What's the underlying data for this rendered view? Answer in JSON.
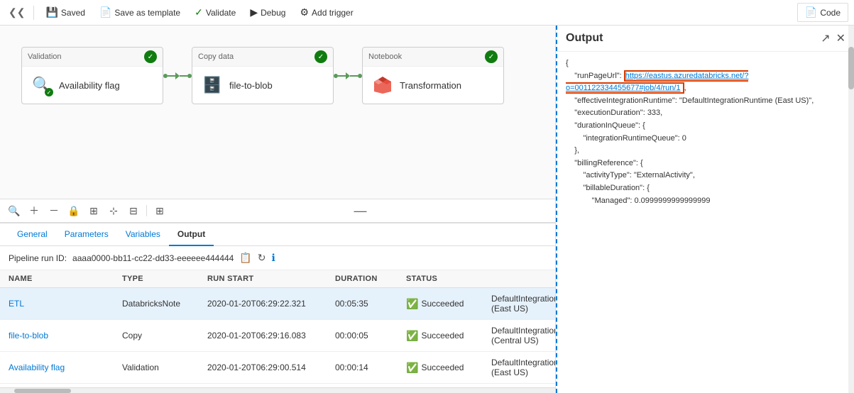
{
  "toolbar": {
    "saved_label": "Saved",
    "save_template_label": "Save as template",
    "validate_label": "Validate",
    "debug_label": "Debug",
    "add_trigger_label": "Add trigger",
    "code_label": "Code"
  },
  "pipeline": {
    "activities": [
      {
        "id": "validation",
        "type_label": "Validation",
        "name": "Availability flag",
        "icon": "🔍",
        "icon_color": "#0078d4",
        "success": true
      },
      {
        "id": "copy-data",
        "type_label": "Copy data",
        "name": "file-to-blob",
        "icon": "🗄",
        "icon_color": "#555",
        "success": true
      },
      {
        "id": "notebook",
        "type_label": "Notebook",
        "name": "Transformation",
        "icon": "🔶",
        "icon_color": "#d83b01",
        "success": true
      }
    ]
  },
  "tabs": [
    {
      "label": "General",
      "active": false
    },
    {
      "label": "Parameters",
      "active": false
    },
    {
      "label": "Variables",
      "active": false
    },
    {
      "label": "Output",
      "active": true
    }
  ],
  "run_info": {
    "label": "Pipeline run ID:",
    "id": "aaaa0000-bb11-cc22-dd33-eeeeee444444"
  },
  "table": {
    "headers": [
      "NAME",
      "TYPE",
      "RUN START",
      "DURATION",
      "STATUS",
      "",
      ""
    ],
    "rows": [
      {
        "name": "ETL",
        "type": "DatabricksNote",
        "run_start": "2020-01-20T06:29:22.321",
        "duration": "00:05:35",
        "status": "Succeeded",
        "runtime": "DefaultIntegrationRuntime (East US)",
        "selected": true
      },
      {
        "name": "file-to-blob",
        "type": "Copy",
        "run_start": "2020-01-20T06:29:16.083",
        "duration": "00:00:05",
        "status": "Succeeded",
        "runtime": "DefaultIntegrationRuntime (Central US)",
        "selected": false
      },
      {
        "name": "Availability flag",
        "type": "Validation",
        "run_start": "2020-01-20T06:29:00.514",
        "duration": "00:00:14",
        "status": "Succeeded",
        "runtime": "DefaultIntegrationRuntime (East US)",
        "selected": false
      }
    ]
  },
  "output": {
    "title": "Output",
    "content_lines": [
      {
        "text": "{",
        "type": "plain"
      },
      {
        "text": "    \"runPageUrl\": ",
        "type": "key",
        "link": "https://eastus.azuredatabricks.net/?o=001122334455677#job/4/run/1",
        "link_text": "https://eastus.azuredatabricks.net/?o=001122334455677#job/4/run/1",
        "highlighted": true
      },
      {
        "text": "    \"effectiveIntegrationRuntime\": \"DefaultIntegrationRuntime (East US)\",",
        "type": "plain"
      },
      {
        "text": "    \"executionDuration\": 333,",
        "type": "plain"
      },
      {
        "text": "    \"durationInQueue\": {",
        "type": "plain"
      },
      {
        "text": "        \"integrationRuntimeQueue\": 0",
        "type": "plain"
      },
      {
        "text": "    },",
        "type": "plain"
      },
      {
        "text": "    \"billingReference\": {",
        "type": "plain"
      },
      {
        "text": "        \"activityType\": \"ExternalActivity\",",
        "type": "plain"
      },
      {
        "text": "        \"billableDuration\": {",
        "type": "plain"
      },
      {
        "text": "            \"Managed\": 0.0999999999999999",
        "type": "plain"
      }
    ]
  }
}
